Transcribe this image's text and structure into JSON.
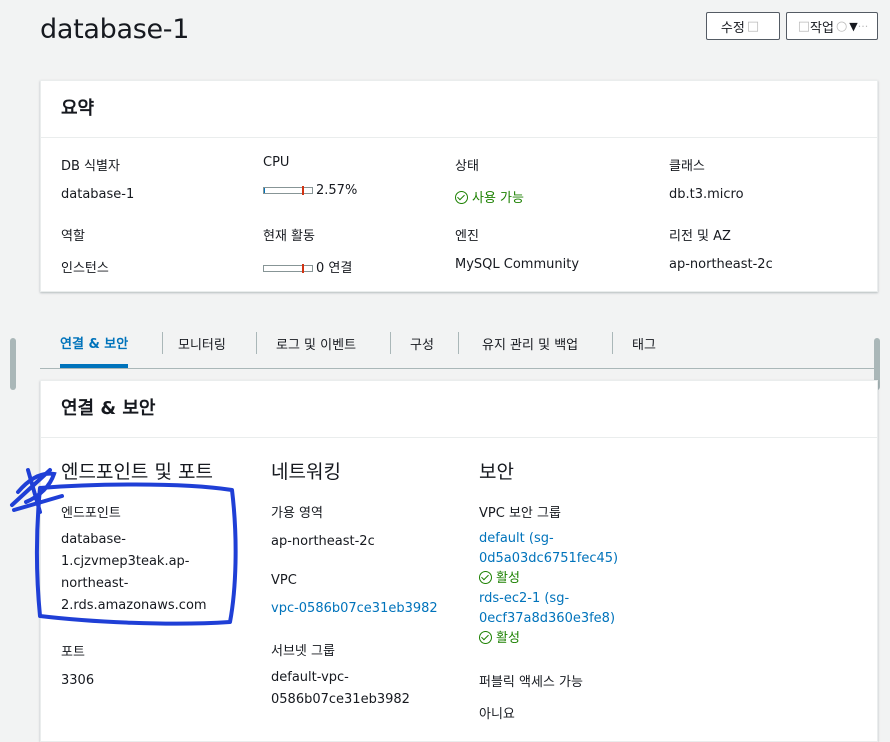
{
  "header": {
    "title": "database-1",
    "edit_label": "수정",
    "action_label": "작업",
    "action_caret": "▼"
  },
  "summary": {
    "heading": "요약",
    "db_id": {
      "label": "DB 식별자",
      "value": "database-1"
    },
    "cpu": {
      "label": "CPU",
      "value": "2.57%",
      "percent": 2.57
    },
    "status": {
      "label": "상태",
      "value": "사용 가능"
    },
    "class": {
      "label": "클래스",
      "value": "db.t3.micro"
    },
    "role": {
      "label": "역할",
      "value": "인스턴스"
    },
    "activity": {
      "label": "현재 활동",
      "value": "0 연결",
      "connections": 0
    },
    "engine": {
      "label": "엔진",
      "value": "MySQL Community"
    },
    "region": {
      "label": "리전 및 AZ",
      "value": "ap-northeast-2c"
    }
  },
  "tabs": [
    {
      "label": "연결 & 보안",
      "active": true
    },
    {
      "label": "모니터링"
    },
    {
      "label": "로그 및 이벤트"
    },
    {
      "label": "구성"
    },
    {
      "label": "유지 관리 및 백업"
    },
    {
      "label": "태그"
    }
  ],
  "connectivity": {
    "heading": "연결 & 보안",
    "endpoint_section": "엔드포인트 및 포트",
    "endpoint_label": "엔드포인트",
    "endpoint_lines": [
      "database-",
      "1.cjzvmep3teak.ap-",
      "northeast-",
      "2.rds.amazonaws.com"
    ],
    "port_label": "포트",
    "port_value": "3306",
    "network_section": "네트워킹",
    "az_label": "가용 영역",
    "az_value": "ap-northeast-2c",
    "vpc_label": "VPC",
    "vpc_value": "vpc-0586b07ce31eb3982",
    "subnet_label": "서브넷 그룹",
    "subnet_lines": [
      "default-vpc-",
      "0586b07ce31eb3982"
    ],
    "security_section": "보안",
    "sg_label": "VPC 보안 그룹",
    "sg1_lines": [
      "default (sg-",
      "0d5a03dc6751fec45)"
    ],
    "sg1_status": "활성",
    "sg2_lines": [
      "rds-ec2-1 (sg-",
      "0ecf37a8d360e3fe8)"
    ],
    "sg2_status": "활성",
    "public_label": "퍼블릭 액세스 가능",
    "public_value": "아니요"
  },
  "colors": {
    "link": "#0073bb",
    "success": "#1d8102",
    "annotation": "#1f3fd6"
  }
}
